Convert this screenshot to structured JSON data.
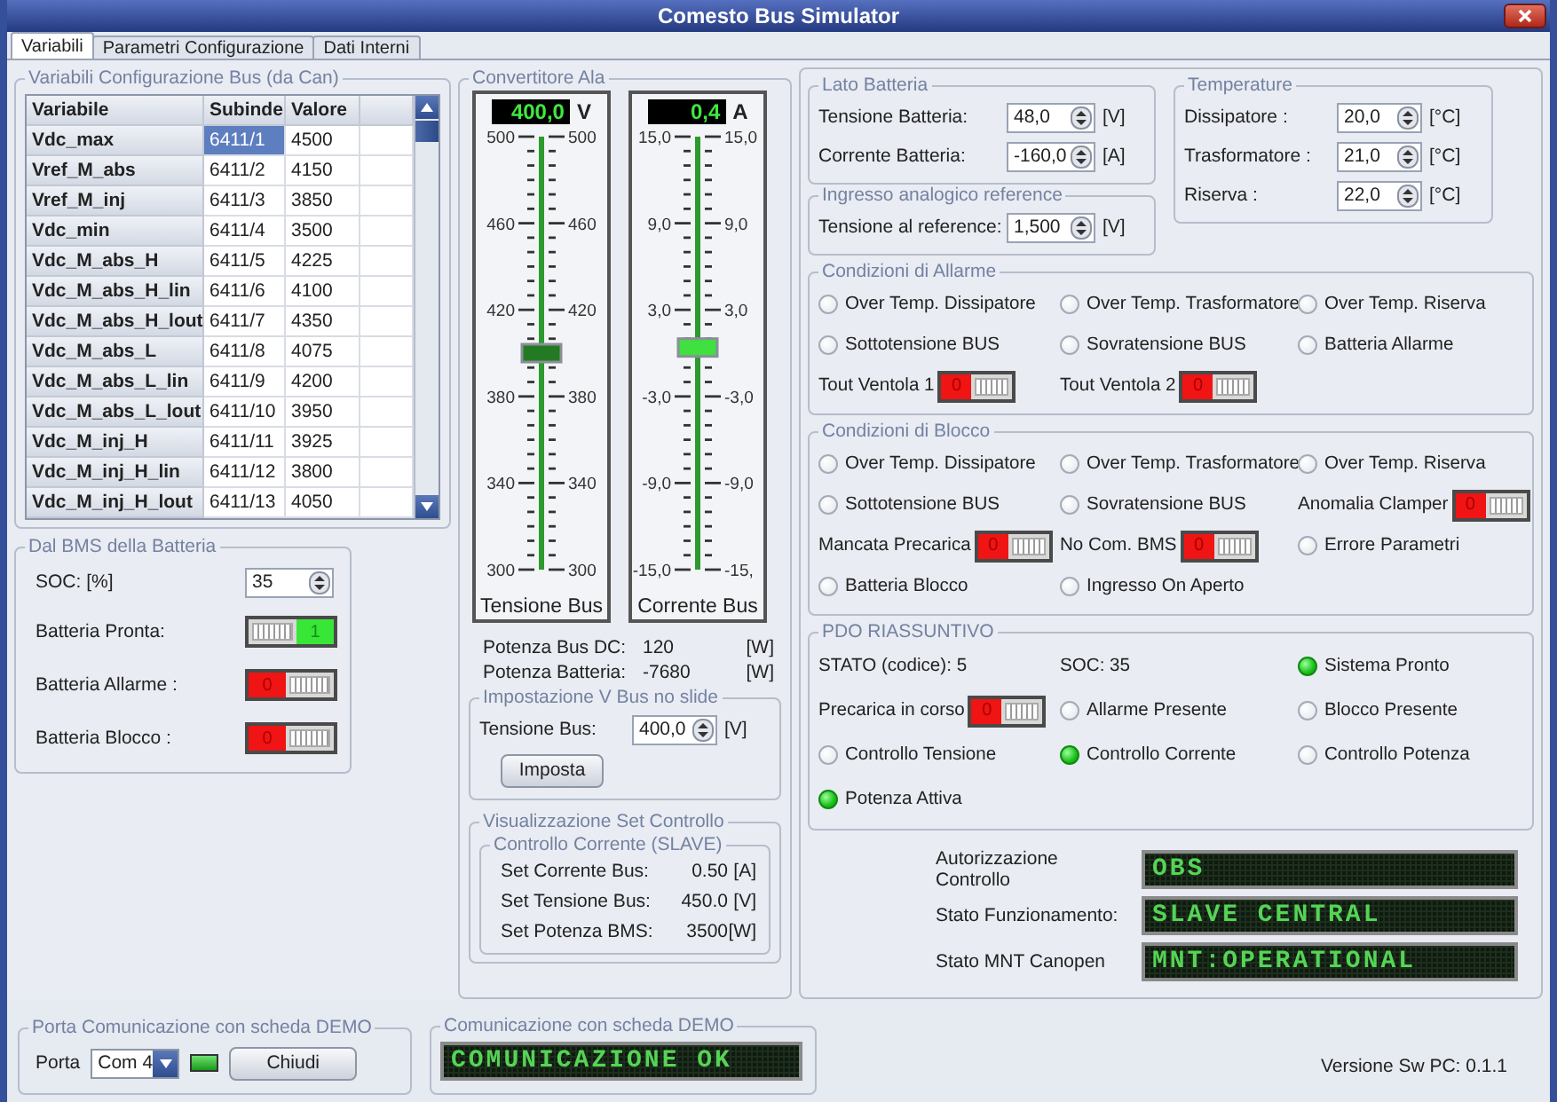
{
  "window": {
    "title": "Comesto Bus Simulator"
  },
  "tabs": [
    {
      "label": "Variabili",
      "selected": true
    },
    {
      "label": "Parametri Configurazione",
      "selected": false
    },
    {
      "label": "Dati Interni",
      "selected": false
    }
  ],
  "config_table": {
    "title": "Variabili Configurazione Bus (da Can)",
    "columns": [
      "Variabile",
      "Subinde",
      "Valore"
    ],
    "rows": [
      {
        "variabile": "Vdc_max",
        "subindex": "6411/1",
        "valore": "4500",
        "selected": true
      },
      {
        "variabile": "Vref_M_abs",
        "subindex": "6411/2",
        "valore": "4150",
        "selected": false
      },
      {
        "variabile": "Vref_M_inj",
        "subindex": "6411/3",
        "valore": "3850",
        "selected": false
      },
      {
        "variabile": "Vdc_min",
        "subindex": "6411/4",
        "valore": "3500",
        "selected": false
      },
      {
        "variabile": "Vdc_M_abs_H",
        "subindex": "6411/5",
        "valore": "4225",
        "selected": false
      },
      {
        "variabile": "Vdc_M_abs_H_lin",
        "subindex": "6411/6",
        "valore": "4100",
        "selected": false
      },
      {
        "variabile": "Vdc_M_abs_H_lout",
        "subindex": "6411/7",
        "valore": "4350",
        "selected": false
      },
      {
        "variabile": "Vdc_M_abs_L",
        "subindex": "6411/8",
        "valore": "4075",
        "selected": false
      },
      {
        "variabile": "Vdc_M_abs_L_lin",
        "subindex": "6411/9",
        "valore": "4200",
        "selected": false
      },
      {
        "variabile": "Vdc_M_abs_L_lout",
        "subindex": "6411/10",
        "valore": "3950",
        "selected": false
      },
      {
        "variabile": "Vdc_M_inj_H",
        "subindex": "6411/11",
        "valore": "3925",
        "selected": false
      },
      {
        "variabile": "Vdc_M_inj_H_lin",
        "subindex": "6411/12",
        "valore": "3800",
        "selected": false
      },
      {
        "variabile": "Vdc_M_inj_H_lout",
        "subindex": "6411/13",
        "valore": "4050",
        "selected": false
      }
    ]
  },
  "bms": {
    "title": "Dal BMS della Batteria",
    "soc": {
      "label": "SOC: [%]",
      "value": "35"
    },
    "toggles": [
      {
        "label": "Batteria Pronta:",
        "on": true,
        "text": "1"
      },
      {
        "label": "Batteria Allarme :",
        "on": false,
        "text": "0"
      },
      {
        "label": "Batteria Blocco :",
        "on": false,
        "text": "0"
      }
    ]
  },
  "converter": {
    "title": "Convertitore Ala",
    "gauges": [
      {
        "reading": "400,0",
        "unit": "V",
        "level": 0.5,
        "left_ticks": [
          "500",
          "460",
          "420",
          "380",
          "340",
          "300"
        ],
        "right_ticks": [
          "500",
          "460",
          "420",
          "380",
          "340",
          "300"
        ],
        "caption": "Tensione Bus"
      },
      {
        "reading": "0,4",
        "unit": "A",
        "level": 0.513,
        "left_ticks": [
          "15,0",
          "9,0",
          "3,0",
          "-3,0",
          "-9,0",
          "-15,0"
        ],
        "right_ticks": [
          "15,0",
          "9,0",
          "3,0",
          "-3,0",
          "-9,0",
          "-15,"
        ],
        "caption": "Corrente Bus"
      }
    ],
    "power": [
      {
        "label": "Potenza Bus DC:",
        "value": "120",
        "unit": "[W]"
      },
      {
        "label": "Potenza Batteria:",
        "value": "-7680",
        "unit": "[W]"
      }
    ],
    "setpoint": {
      "title": "Impostazione V Bus no slide",
      "label": "Tensione Bus:",
      "value": "400,0",
      "unit": "[V]",
      "button": "Imposta"
    },
    "control": {
      "title": "Visualizzazione Set Controllo",
      "subtitle": "Controllo Corrente (SLAVE)",
      "rows": [
        {
          "label": "Set Corrente Bus:",
          "value": "0.50",
          "unit": "[A]"
        },
        {
          "label": "Set Tensione Bus:",
          "value": "450.0",
          "unit": "[V]"
        },
        {
          "label": "Set Potenza BMS:",
          "value": "3500",
          "unit": "[W]"
        }
      ]
    }
  },
  "battery_side": {
    "title": "Lato Batteria",
    "fields": [
      {
        "label": "Tensione  Batteria:",
        "value": "48,0",
        "unit": "[V]"
      },
      {
        "label": "Corrente  Batteria:",
        "value": "-160,0",
        "unit": "[A]"
      }
    ]
  },
  "analog_input": {
    "title": "Ingresso analogico reference",
    "fields": [
      {
        "label": "Tensione  al reference:",
        "value": "1,500",
        "unit": "[V]"
      }
    ]
  },
  "temperatures": {
    "title": "Temperature",
    "fields": [
      {
        "label": "Dissipatore :",
        "value": "20,0",
        "unit": "[°C]"
      },
      {
        "label": "Trasformatore :",
        "value": "21,0",
        "unit": "[°C]"
      },
      {
        "label": "Riserva :",
        "value": "22,0",
        "unit": "[°C]"
      }
    ]
  },
  "alarms": {
    "title": "Condizioni di Allarme",
    "items": [
      {
        "kind": "radio",
        "label": "Over Temp. Dissipatore",
        "on": false
      },
      {
        "kind": "radio",
        "label": "Over Temp. Trasformatore",
        "on": false
      },
      {
        "kind": "radio",
        "label": "Over Temp. Riserva",
        "on": false
      },
      {
        "kind": "radio",
        "label": "Sottotensione BUS",
        "on": false
      },
      {
        "kind": "radio",
        "label": "Sovratensione BUS",
        "on": false
      },
      {
        "kind": "radio",
        "label": "Batteria Allarme",
        "on": false
      },
      {
        "kind": "toggle",
        "label": "Tout Ventola 1",
        "on": false,
        "text": "0"
      },
      {
        "kind": "toggle",
        "label": "Tout Ventola 2",
        "on": false,
        "text": "0"
      }
    ]
  },
  "blocks": {
    "title": "Condizioni di Blocco",
    "items": [
      {
        "kind": "radio",
        "label": "Over Temp. Dissipatore",
        "on": false
      },
      {
        "kind": "radio",
        "label": "Over Temp. Trasformatore",
        "on": false
      },
      {
        "kind": "radio",
        "label": "Over Temp. Riserva",
        "on": false
      },
      {
        "kind": "radio",
        "label": "Sottotensione BUS",
        "on": false
      },
      {
        "kind": "radio",
        "label": "Sovratensione BUS",
        "on": false
      },
      {
        "kind": "toggle",
        "label": "Anomalia Clamper",
        "on": false,
        "text": "0"
      },
      {
        "kind": "toggle",
        "label": "Mancata Precarica",
        "on": false,
        "text": "0"
      },
      {
        "kind": "toggle",
        "label": "No Com. BMS",
        "on": false,
        "text": "0"
      },
      {
        "kind": "radio",
        "label": "Errore Parametri",
        "on": false
      },
      {
        "kind": "radio",
        "label": "Batteria Blocco",
        "on": false
      },
      {
        "kind": "radio",
        "label": "Ingresso On Aperto",
        "on": false
      }
    ]
  },
  "pdo": {
    "title": "PDO RIASSUNTIVO",
    "items": [
      {
        "kind": "text",
        "label": "STATO (codice): 5"
      },
      {
        "kind": "text",
        "label": "SOC: 35"
      },
      {
        "kind": "radio",
        "label": "Sistema Pronto",
        "on": true
      },
      {
        "kind": "toggle",
        "label": "Precarica in corso",
        "on": false,
        "text": "0"
      },
      {
        "kind": "radio",
        "label": "Allarme Presente",
        "on": false
      },
      {
        "kind": "radio",
        "label": "Blocco Presente",
        "on": false
      },
      {
        "kind": "radio",
        "label": "Controllo Tensione",
        "on": false
      },
      {
        "kind": "radio",
        "label": "Controllo Corrente",
        "on": true
      },
      {
        "kind": "radio",
        "label": "Controllo Potenza",
        "on": false
      },
      {
        "kind": "radio",
        "label": "Potenza Attiva",
        "on": true
      }
    ]
  },
  "status_displays": [
    {
      "label": "Autorizzazione Controllo",
      "value": "OBS"
    },
    {
      "label": "Stato Funzionamento:",
      "value": "SLAVE CENTRAL"
    },
    {
      "label": "Stato MNT Canopen",
      "value": "MNT:OPERATIONAL"
    }
  ],
  "port": {
    "title": "Porta Comunicazione con scheda DEMO",
    "label": "Porta",
    "value": "Com 4",
    "connected": true,
    "button": "Chiudi"
  },
  "communication": {
    "title": "Comunicazione con scheda DEMO",
    "value": "COMUNICAZIONE OK"
  },
  "version": "Versione Sw PC: 0.1.1"
}
